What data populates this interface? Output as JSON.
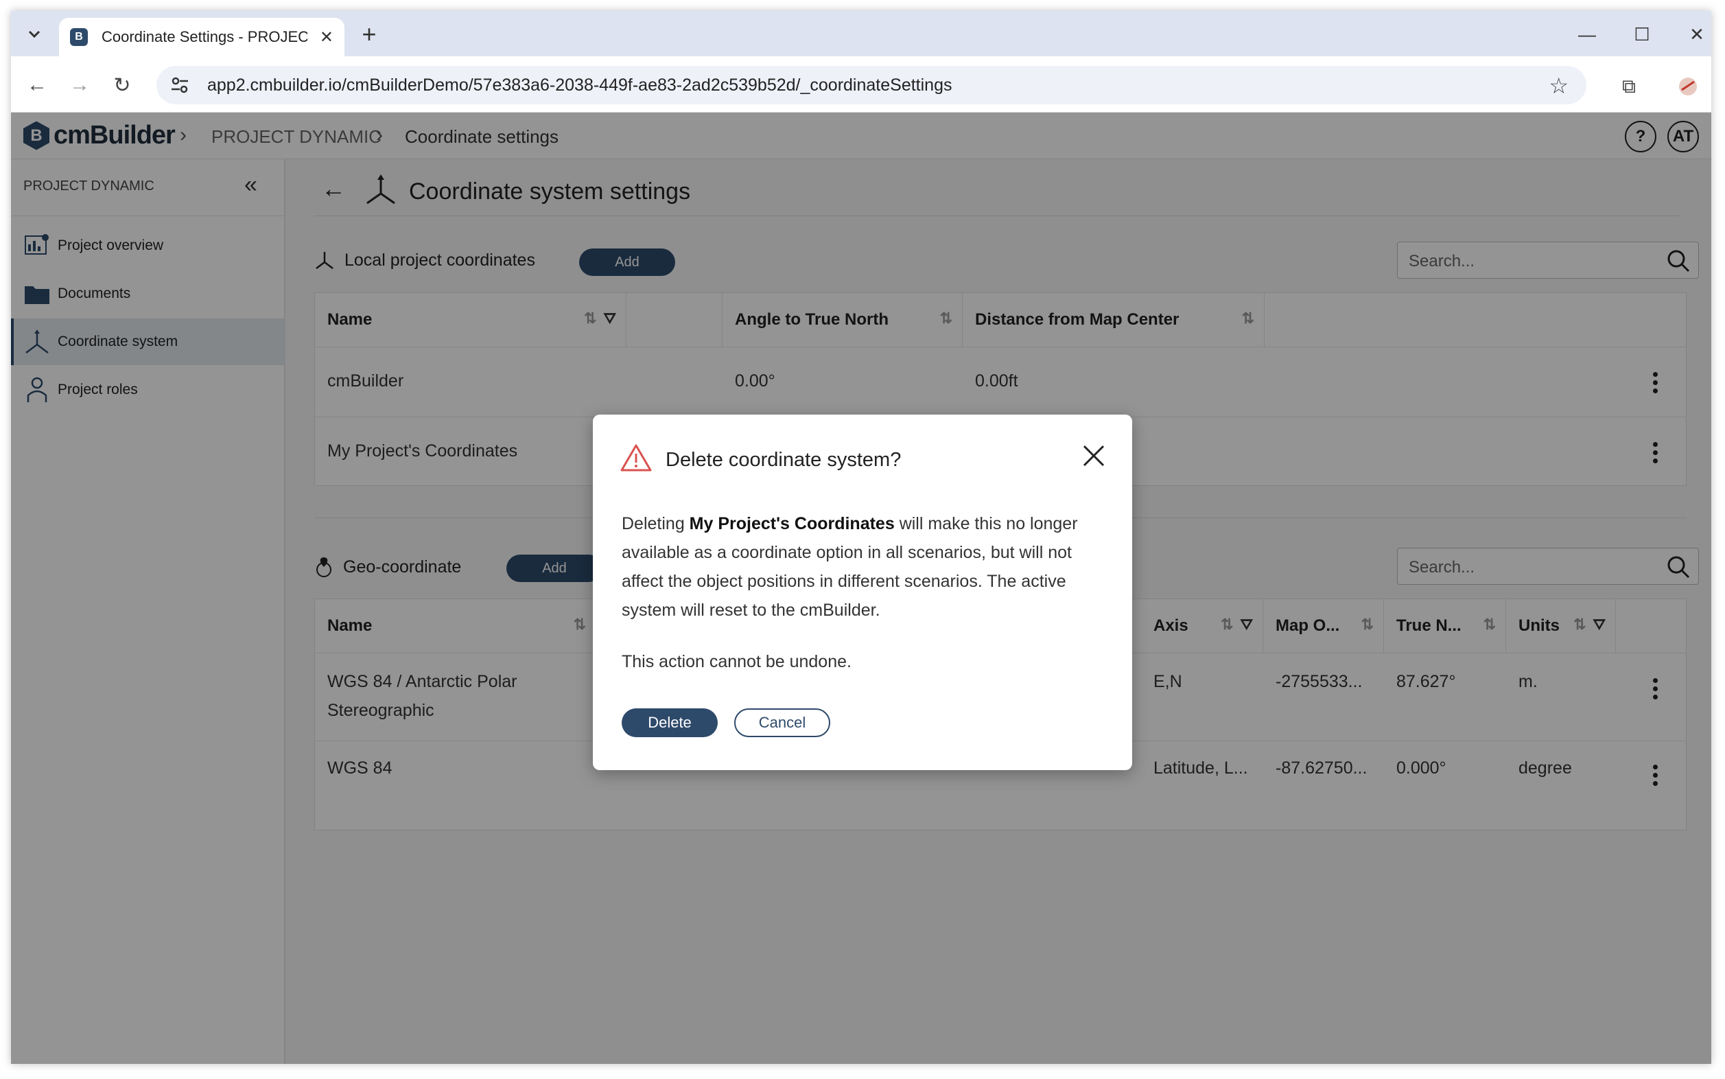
{
  "browser": {
    "tab_title": "Coordinate Settings - PROJECT",
    "url": "app2.cmbuilder.io/cmBuilderDemo/57e383a6-2038-449f-ae83-2ad2c539b52d/_coordinateSettings"
  },
  "header": {
    "logo_text": "cmBuilder",
    "logo_mark": "B",
    "breadcrumb": [
      "PROJECT DYNAMIC",
      "Coordinate settings"
    ],
    "help_label": "?",
    "avatar_initials": "AT"
  },
  "sidebar": {
    "title": "PROJECT DYNAMIC",
    "items": [
      {
        "label": "Project overview",
        "icon": "dashboard-icon"
      },
      {
        "label": "Documents",
        "icon": "folder-icon"
      },
      {
        "label": "Coordinate system",
        "icon": "axes-icon",
        "active": true
      },
      {
        "label": "Project roles",
        "icon": "person-icon"
      }
    ]
  },
  "main": {
    "title": "Coordinate system settings",
    "local": {
      "label": "Local project coordinates",
      "add_label": "Add",
      "search_placeholder": "Search...",
      "columns": [
        "Name",
        "Angle to True North",
        "Distance from Map Center"
      ],
      "rows": [
        {
          "name": "cmBuilder",
          "angle": "0.00°",
          "distance": "0.00ft"
        },
        {
          "name": "My Project's Coordinates",
          "angle": "",
          "distance": ""
        }
      ]
    },
    "geo": {
      "label": "Geo-coordinate",
      "add_label": "Add",
      "search_placeholder": "Search...",
      "columns": [
        "Name",
        "Axis",
        "Map O...",
        "True N...",
        "Units"
      ],
      "rows": [
        {
          "name": "WGS 84 / Antarctic Polar Stereographic",
          "axis": "E,N",
          "map_origin": "-2755533...",
          "true_north": "87.627°",
          "units": "m."
        },
        {
          "name": "WGS 84",
          "axis": "Latitude, L...",
          "map_origin": "-87.62750...",
          "true_north": "0.000°",
          "units": "degree"
        }
      ]
    }
  },
  "dialog": {
    "title": "Delete coordinate system?",
    "body_prefix": "Deleting ",
    "body_bold": "My Project's Coordinates",
    "body_suffix": " will make this no longer available as a coordinate option in all scenarios, but will not affect the object positions in different scenarios. The active system will reset to the cmBuilder.",
    "note": "This action cannot be undone.",
    "delete_label": "Delete",
    "cancel_label": "Cancel"
  },
  "colors": {
    "accent": "#2e4a6b",
    "warning": "#d9534f"
  }
}
